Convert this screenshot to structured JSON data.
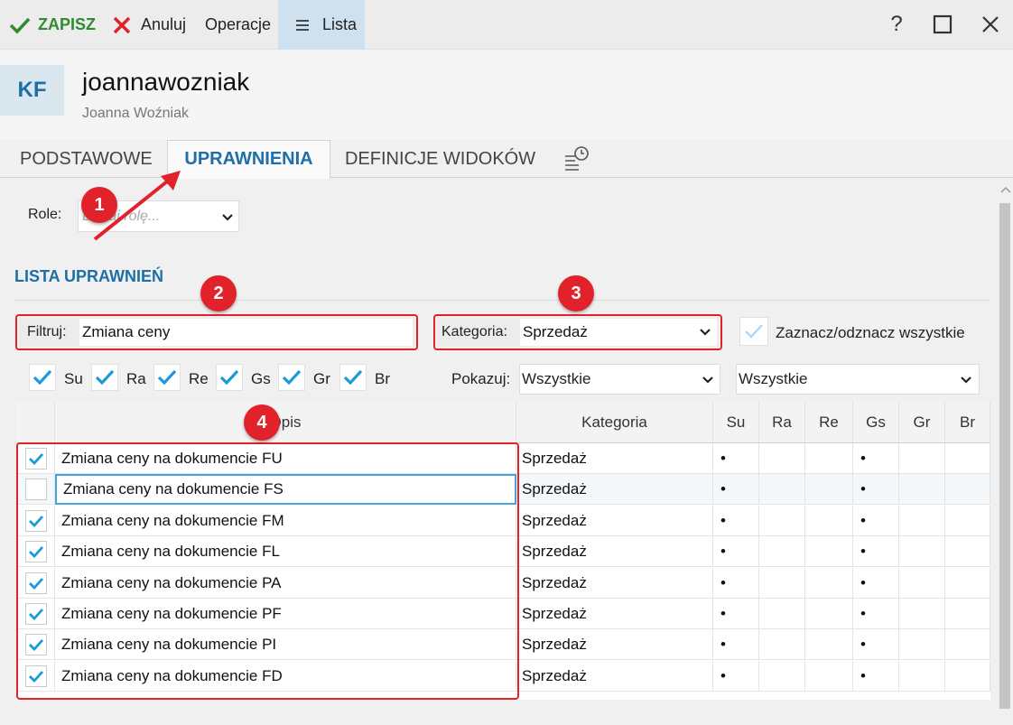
{
  "toolbar": {
    "save_label": "ZAPISZ",
    "cancel_label": "Anuluj",
    "operations_label": "Operacje",
    "list_label": "Lista",
    "help_label": "?"
  },
  "header": {
    "avatar_initials": "KF",
    "username": "joannawozniak",
    "full_name": "Joanna Woźniak"
  },
  "tabs": [
    {
      "label": "PODSTAWOWE"
    },
    {
      "label": "UPRAWNIENIA",
      "active": true
    },
    {
      "label": "DEFINICJE WIDOKÓW"
    }
  ],
  "role": {
    "label": "Role:",
    "placeholder": "Dodaj rolę..."
  },
  "section": {
    "title": "LISTA UPRAWNIEŃ"
  },
  "filter": {
    "label": "Filtruj:",
    "value": "Zmiana ceny"
  },
  "category": {
    "label": "Kategoria:",
    "value": "Sprzedaż"
  },
  "select_all_label": "Zaznacz/odznacz wszystkie",
  "column_toggles": [
    {
      "label": "Su",
      "checked": true
    },
    {
      "label": "Ra",
      "checked": true
    },
    {
      "label": "Re",
      "checked": true
    },
    {
      "label": "Gs",
      "checked": true
    },
    {
      "label": "Gr",
      "checked": true
    },
    {
      "label": "Br",
      "checked": true
    }
  ],
  "show": {
    "label": "Pokazuj:",
    "value1": "Wszystkie",
    "value2": "Wszystkie"
  },
  "table": {
    "headers": [
      "Opis",
      "Kategoria",
      "Su",
      "Ra",
      "Re",
      "Gs",
      "Gr",
      "Br"
    ],
    "rows": [
      {
        "checked": true,
        "desc": "Zmiana ceny na dokumencie FU",
        "category": "Sprzedaż",
        "su": "•",
        "gs": "•"
      },
      {
        "checked": false,
        "desc": "Zmiana ceny na dokumencie FS",
        "category": "Sprzedaż",
        "su": "•",
        "gs": "•"
      },
      {
        "checked": true,
        "desc": "Zmiana ceny na dokumencie FM",
        "category": "Sprzedaż",
        "su": "•",
        "gs": "•"
      },
      {
        "checked": true,
        "desc": "Zmiana ceny na dokumencie FL",
        "category": "Sprzedaż",
        "su": "•",
        "gs": "•"
      },
      {
        "checked": true,
        "desc": "Zmiana ceny na dokumencie PA",
        "category": "Sprzedaż",
        "su": "•",
        "gs": "•"
      },
      {
        "checked": true,
        "desc": "Zmiana ceny na dokumencie PF",
        "category": "Sprzedaż",
        "su": "•",
        "gs": "•"
      },
      {
        "checked": true,
        "desc": "Zmiana ceny na dokumencie PI",
        "category": "Sprzedaż",
        "su": "•",
        "gs": "•"
      },
      {
        "checked": true,
        "desc": "Zmiana ceny na dokumencie FD",
        "category": "Sprzedaż",
        "su": "•",
        "gs": "•"
      }
    ]
  },
  "annotations": [
    "1",
    "2",
    "3",
    "4"
  ],
  "colors": {
    "accent": "#1d6fa5",
    "check": "#1a9bd7",
    "save_green": "#2e8b2e",
    "annotation_red": "#e2222a"
  }
}
